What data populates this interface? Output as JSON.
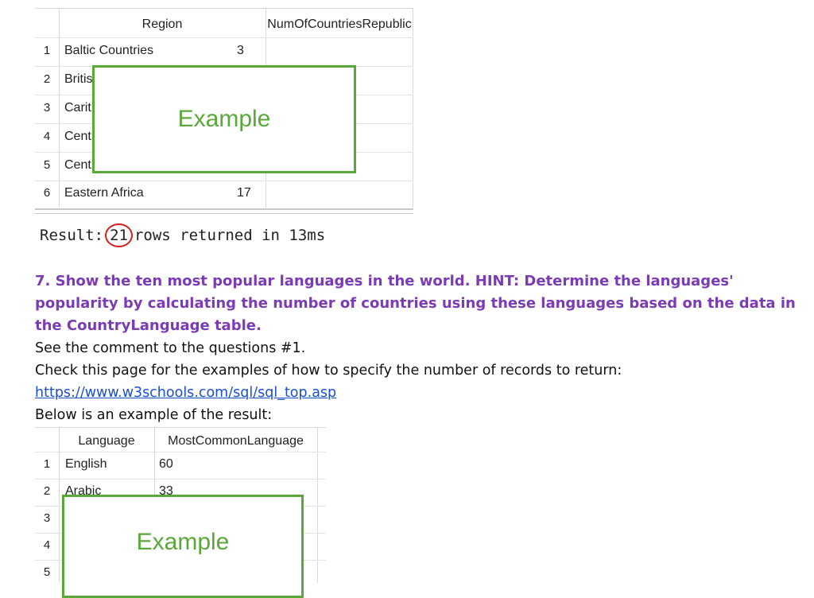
{
  "table1": {
    "headers": [
      "Region",
      "NumOfCountriesRepublic"
    ],
    "rows": [
      {
        "n": "1",
        "region": "Baltic Countries",
        "value": "3"
      },
      {
        "n": "2",
        "region": "Britis",
        "value": ""
      },
      {
        "n": "3",
        "region": "Carit",
        "value": ""
      },
      {
        "n": "4",
        "region": "Cent",
        "value": ""
      },
      {
        "n": "5",
        "region": "Cent",
        "value": ""
      },
      {
        "n": "6",
        "region": "Eastern Africa",
        "value": "17"
      }
    ],
    "overlay": "Example"
  },
  "result": {
    "prefix": "Result:",
    "count": "21",
    "suffix": "rows returned in 13ms"
  },
  "question": {
    "text": "7. Show the ten most popular languages in the world. HINT: Determine the languages' popularity by calculating the number of countries using these languages based on the data in the CountryLanguage table.",
    "comment": "See the comment to the questions #1.",
    "check": "Check this page for the examples of how to specify the number of records to return:",
    "link": "https://www.w3schools.com/sql/sql_top.asp",
    "below": "Below is an example of the result:"
  },
  "table2": {
    "headers": [
      "Language",
      "MostCommonLanguage"
    ],
    "rows": [
      {
        "n": "1",
        "lang": "English",
        "value": "60"
      },
      {
        "n": "2",
        "lang": "Arabic",
        "value": "33"
      },
      {
        "n": "3",
        "lang": "",
        "value": ""
      },
      {
        "n": "4",
        "lang": "",
        "value": ""
      },
      {
        "n": "5",
        "lang": "",
        "value": ""
      }
    ],
    "overlay": "Example"
  }
}
